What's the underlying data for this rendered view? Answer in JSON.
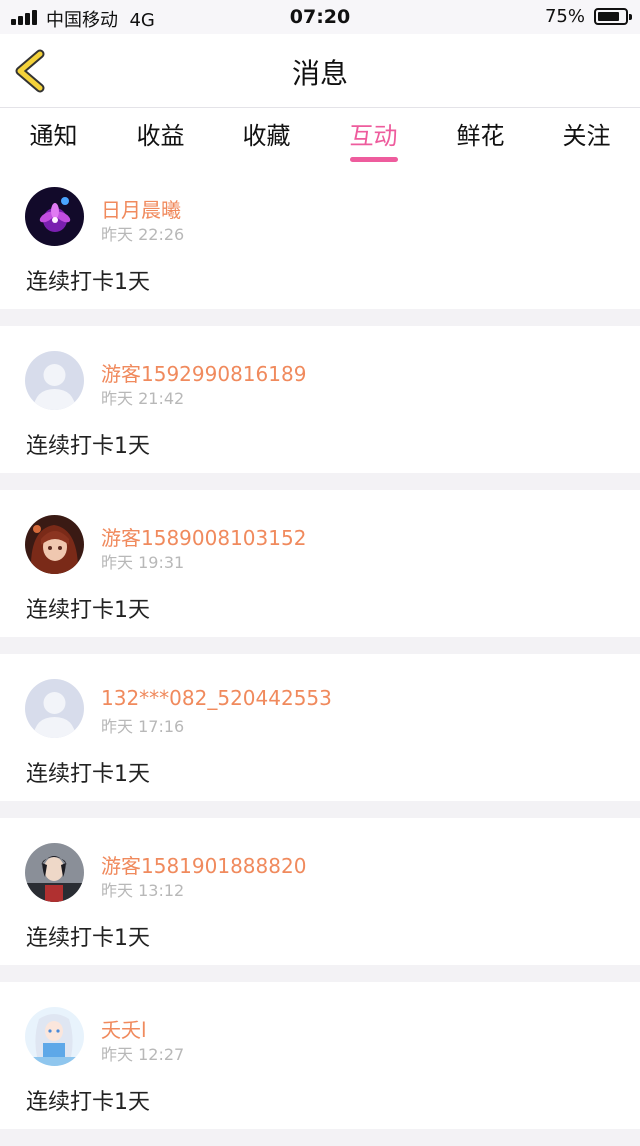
{
  "status_bar": {
    "carrier": "中国移动",
    "network": "4G",
    "time": "07:20",
    "battery": "75%"
  },
  "nav": {
    "title": "消息",
    "back_icon": "chevron-left-icon"
  },
  "tabs": [
    {
      "label": "通知"
    },
    {
      "label": "收益"
    },
    {
      "label": "收藏"
    },
    {
      "label": "互动",
      "active": true
    },
    {
      "label": "鲜花"
    },
    {
      "label": "关注"
    }
  ],
  "colors": {
    "accent": "#ee5c9d",
    "username": "#f08a5d",
    "timestamp": "#b8b8b8",
    "back_arrow": "#f4d23a"
  },
  "messages": [
    {
      "user": "日月晨曦",
      "time": "昨天 22:26",
      "text": "连续打卡1天",
      "avatar": "purple-flower-avatar"
    },
    {
      "user": "游客1592990816189",
      "time": "昨天 21:42",
      "text": "连续打卡1天",
      "avatar": "default-person-avatar"
    },
    {
      "user": "游客1589008103152",
      "time": "昨天 19:31",
      "text": "连续打卡1天",
      "avatar": "anime-girl-avatar"
    },
    {
      "user": "132***082_520442553",
      "time": "昨天 17:16",
      "text": "连续打卡1天",
      "avatar": "default-person-avatar"
    },
    {
      "user": "游客1581901888820",
      "time": "昨天 13:12",
      "text": "连续打卡1天",
      "avatar": "anime-boy-avatar"
    },
    {
      "user": "夭夭l",
      "time": "昨天 12:27",
      "text": "连续打卡1天",
      "avatar": "anime-white-hair-avatar"
    }
  ]
}
